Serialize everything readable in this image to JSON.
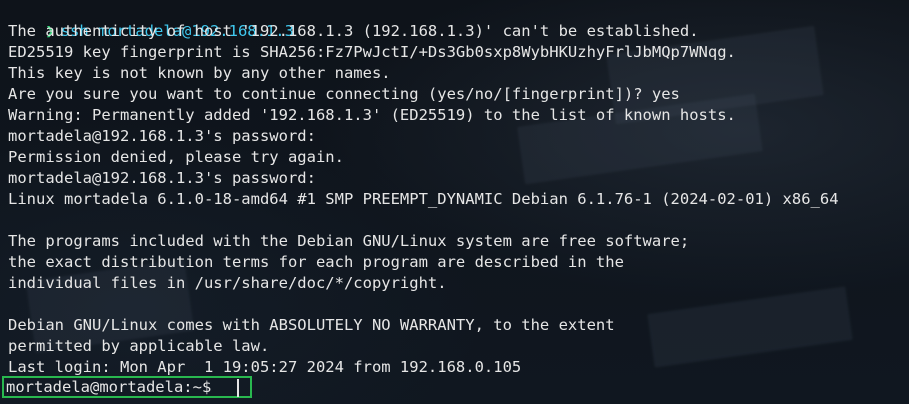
{
  "terminal": {
    "prompt_symbol": "❯",
    "command": "ssh mortadela@192.168.1.3",
    "output_lines": [
      "The authenticity of host '192.168.1.3 (192.168.1.3)' can't be established.",
      "ED25519 key fingerprint is SHA256:Fz7PwJctI/+Ds3Gb0sxp8WybHKUzhyFrlJbMQp7WNqg.",
      "This key is not known by any other names.",
      "Are you sure you want to continue connecting (yes/no/[fingerprint])? yes",
      "Warning: Permanently added '192.168.1.3' (ED25519) to the list of known hosts.",
      "mortadela@192.168.1.3's password:",
      "Permission denied, please try again.",
      "mortadela@192.168.1.3's password:",
      "Linux mortadela 6.1.0-18-amd64 #1 SMP PREEMPT_DYNAMIC Debian 6.1.76-1 (2024-02-01) x86_64",
      "",
      "The programs included with the Debian GNU/Linux system are free software;",
      "the exact distribution terms for each program are described in the",
      "individual files in /usr/share/doc/*/copyright.",
      "",
      "Debian GNU/Linux comes with ABSOLUTELY NO WARRANTY, to the extent",
      "permitted by applicable law.",
      "Last login: Mon Apr  1 19:05:27 2024 from 192.168.0.105"
    ],
    "active_prompt": "mortadela@mortadela:~$",
    "colors": {
      "background": "#0f141b",
      "text": "#e6e6e6",
      "prompt_symbol": "#36d27a",
      "command": "#3fc9ef",
      "highlight_box": "#29b84f"
    }
  }
}
